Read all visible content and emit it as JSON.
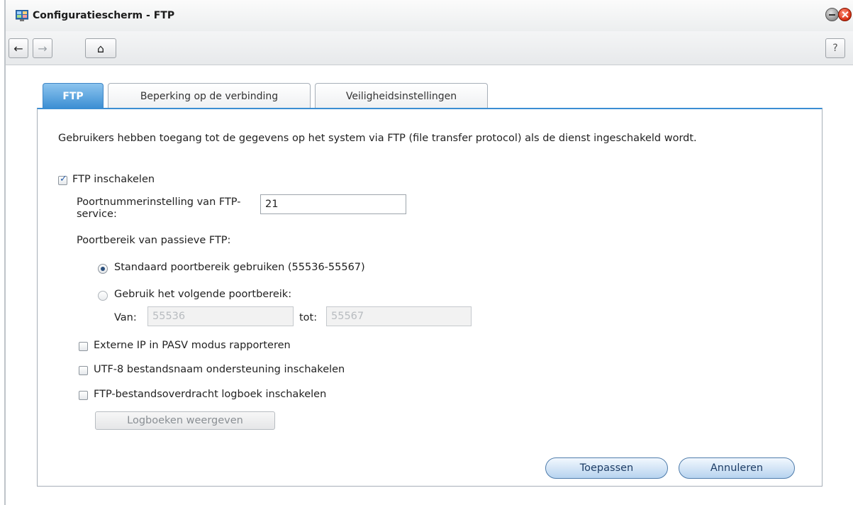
{
  "window": {
    "title": "Configuratiescherm - FTP",
    "icons": [
      "app-icon",
      "minimize-icon",
      "close-icon"
    ]
  },
  "toolbar": {
    "back": "←",
    "forward": "→",
    "home": "⌂",
    "help": "?"
  },
  "tabs": [
    {
      "label": "FTP",
      "active": true
    },
    {
      "label": "Beperking op de verbinding",
      "active": false
    },
    {
      "label": "Veiligheidsinstellingen",
      "active": false
    }
  ],
  "content": {
    "description": "Gebruikers hebben toegang tot de gegevens op het system via FTP (file transfer protocol) als de dienst ingeschakeld wordt.",
    "enable_ftp": {
      "label": "FTP inschakelen",
      "checked": true
    },
    "port_label": "Poortnummerinstelling van FTP-service:",
    "port_value": "21",
    "passive_label": "Poortbereik van passieve FTP:",
    "radio_default": {
      "label": "Standaard poortbereik gebruiken (55536-55567)",
      "selected": true
    },
    "radio_custom": {
      "label": "Gebruik het volgende poortbereik:",
      "selected": false
    },
    "from_label": "Van:",
    "from_value": "55536",
    "to_label": "tot:",
    "to_value": "55567",
    "opt_pasv": {
      "label": "Externe IP in PASV modus rapporteren",
      "checked": false
    },
    "opt_utf8": {
      "label": "UTF-8 bestandsnaam ondersteuning inschakelen",
      "checked": false
    },
    "opt_log": {
      "label": "FTP-bestandsoverdracht logboek inschakelen",
      "checked": false
    },
    "view_logs": "Logboeken weergeven"
  },
  "footer": {
    "apply": "Toepassen",
    "cancel": "Annuleren"
  },
  "colors": {
    "tab_active": "#3b8ed3",
    "close_button": "#d62d10",
    "pill_border": "#4f7cab"
  }
}
